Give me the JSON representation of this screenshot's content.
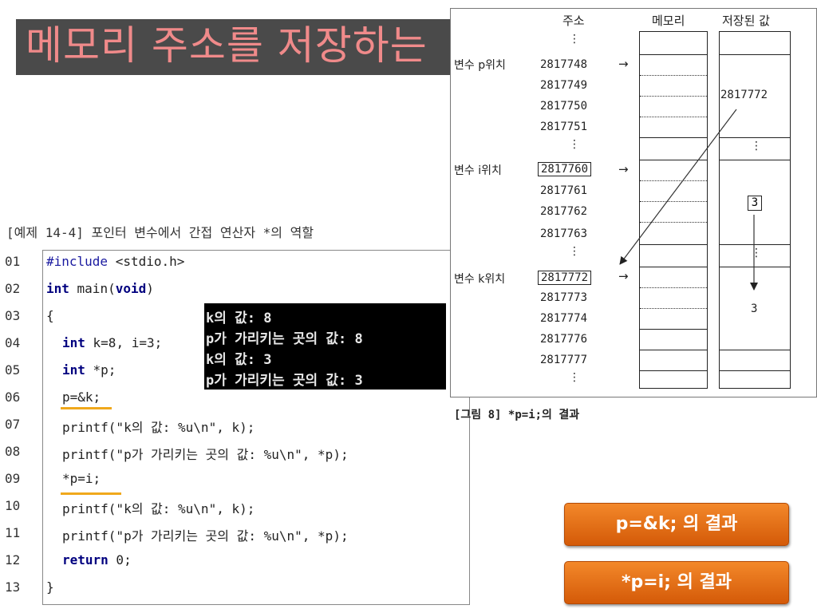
{
  "title": "메모리 주소를 저장하는",
  "example_caption": "[예제 14-4] 포인터 변수에서 간접 연산자 *의 역할",
  "code": {
    "line_numbers": [
      "01",
      "02",
      "03",
      "04",
      "05",
      "06",
      "07",
      "08",
      "09",
      "10",
      "11",
      "12",
      "13"
    ],
    "l01_pp": "#include",
    "l01_rest": " <stdio.h>",
    "l02_kw": "int",
    "l02_mid": " main(",
    "l02_kw2": "void",
    "l02_end": ")",
    "l03": "{",
    "l04_kw": "int",
    "l04_rest": " k=8, i=3;",
    "l05_kw": "int",
    "l05_rest": " *p;",
    "l06": "p=&k;",
    "l07": "printf(\"k의 값: %u\\n\", k);",
    "l08": "printf(\"p가 가리키는 곳의 값: %u\\n\", *p);",
    "l09": "*p=i;",
    "l10": "printf(\"k의 값: %u\\n\", k);",
    "l11": "printf(\"p가 가리키는 곳의 값: %u\\n\", *p);",
    "l12_kw": "return",
    "l12_rest": " 0;",
    "l13": "}"
  },
  "console": {
    "lines": [
      "k의 값: 8",
      "p가 가리키는 곳의 값: 8",
      "k의 값: 3",
      "p가 가리키는 곳의 값: 3"
    ]
  },
  "diagram": {
    "headers": {
      "address": "주소",
      "memory": "메모리",
      "stored_value": "저장된 값"
    },
    "var_p_label": "변수 p위치",
    "var_i_label": "변수 i위치",
    "var_k_label": "변수 k위치",
    "addresses": [
      "2817748",
      "2817749",
      "2817750",
      "2817751",
      "2817760",
      "2817761",
      "2817762",
      "2817763",
      "2817772",
      "2817773",
      "2817774",
      "2817776",
      "2817777"
    ],
    "arrow": "→",
    "dots": "⋮",
    "stored_p": "2817772",
    "stored_i": "3",
    "stored_k": "3"
  },
  "figure_caption": "[그림 8] *p=i;의 결과",
  "buttons": {
    "first": "p=&k; 의 결과",
    "second": "*p=i; 의 결과"
  },
  "colors": {
    "accent_orange": "#e06a12",
    "underline": "#f0a81c",
    "title_text": "#f08a8a",
    "title_bg": "#4a4a4a"
  }
}
